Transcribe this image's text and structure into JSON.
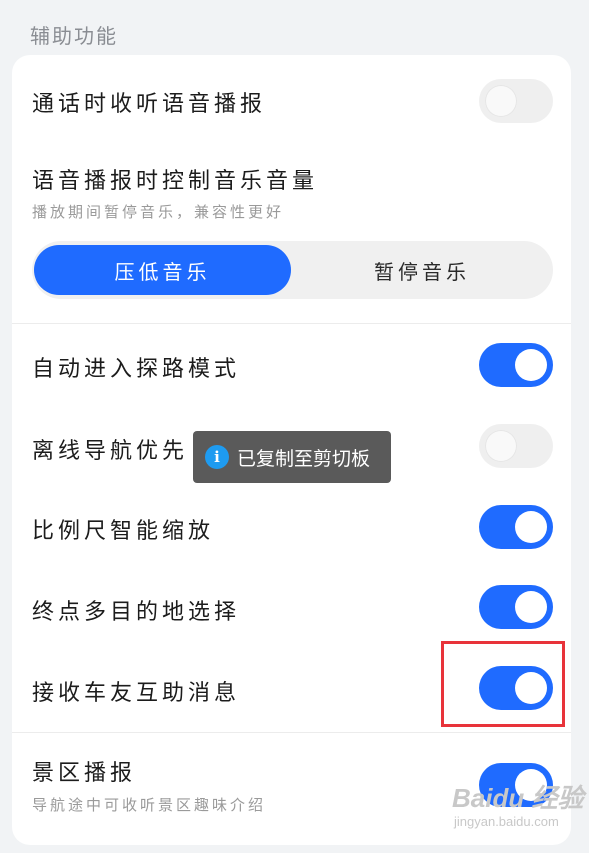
{
  "section_title": "辅助功能",
  "settings": {
    "call_broadcast": {
      "label": "通话时收听语音播报",
      "enabled": false
    },
    "music_control": {
      "label": "语音播报时控制音乐音量",
      "subtitle": "播放期间暂停音乐，兼容性更好",
      "options": [
        "压低音乐",
        "暂停音乐"
      ],
      "selected": "压低音乐"
    },
    "auto_explore": {
      "label": "自动进入探路模式",
      "enabled": true
    },
    "offline_nav": {
      "label": "离线导航优先",
      "enabled": false
    },
    "smart_scale": {
      "label": "比例尺智能缩放",
      "enabled": true
    },
    "multi_destination": {
      "label": "终点多目的地选择",
      "enabled": true
    },
    "car_friend_messages": {
      "label": "接收车友互助消息",
      "enabled": true
    },
    "scenic_broadcast": {
      "label": "景区播报",
      "subtitle": "导航途中可收听景区趣味介绍",
      "enabled": true
    }
  },
  "toast": {
    "icon": "info-icon",
    "text": "已复制至剪切板"
  },
  "watermark": {
    "main": "Baidu 经验",
    "sub": "jingyan.baidu.com"
  },
  "colors": {
    "accent": "#1f6bff",
    "highlight": "#e8333a"
  }
}
